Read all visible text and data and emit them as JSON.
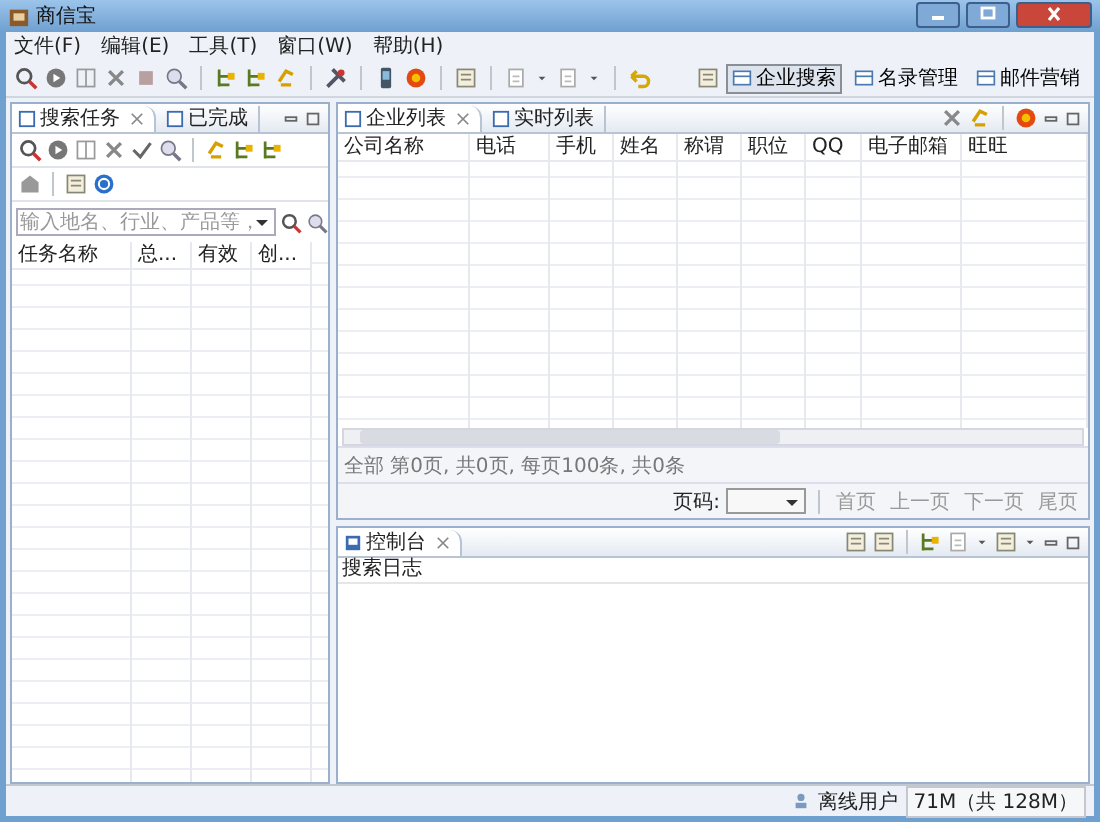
{
  "window": {
    "title": "商信宝"
  },
  "menu": [
    {
      "label": "文件(F)"
    },
    {
      "label": "编辑(E)"
    },
    {
      "label": "工具(T)"
    },
    {
      "label": "窗口(W)"
    },
    {
      "label": "帮助(H)"
    }
  ],
  "perspectives": [
    {
      "label": "企业搜索",
      "selected": true
    },
    {
      "label": "名录管理",
      "selected": false
    },
    {
      "label": "邮件营销",
      "selected": false
    }
  ],
  "left_panel": {
    "tabs": [
      {
        "label": "搜索任务",
        "selected": true
      },
      {
        "label": "已完成",
        "selected": false
      }
    ],
    "search": {
      "placeholder": "输入地名、行业、产品等，"
    },
    "columns": [
      "任务名称",
      "总...",
      "有效",
      "创..."
    ]
  },
  "main": {
    "tabs": [
      {
        "label": "企业列表",
        "selected": true
      },
      {
        "label": "实时列表",
        "selected": false
      }
    ],
    "columns": [
      "公司名称",
      "电话",
      "手机",
      "姓名",
      "称谓",
      "职位",
      "QQ",
      "电子邮箱",
      "旺旺"
    ],
    "summary": "全部 第0页, 共0页, 每页100条, 共0条",
    "page_label": "页码:",
    "pager": [
      {
        "label": "首页",
        "disabled": true
      },
      {
        "label": "上一页",
        "disabled": true
      },
      {
        "label": "下一页",
        "disabled": true
      },
      {
        "label": "尾页",
        "disabled": true
      }
    ]
  },
  "console": {
    "tabs": [
      {
        "label": "控制台",
        "selected": true
      }
    ],
    "heading": "搜索日志"
  },
  "status_bar": {
    "user": "离线用户",
    "memory": "71M（共 128M）"
  }
}
